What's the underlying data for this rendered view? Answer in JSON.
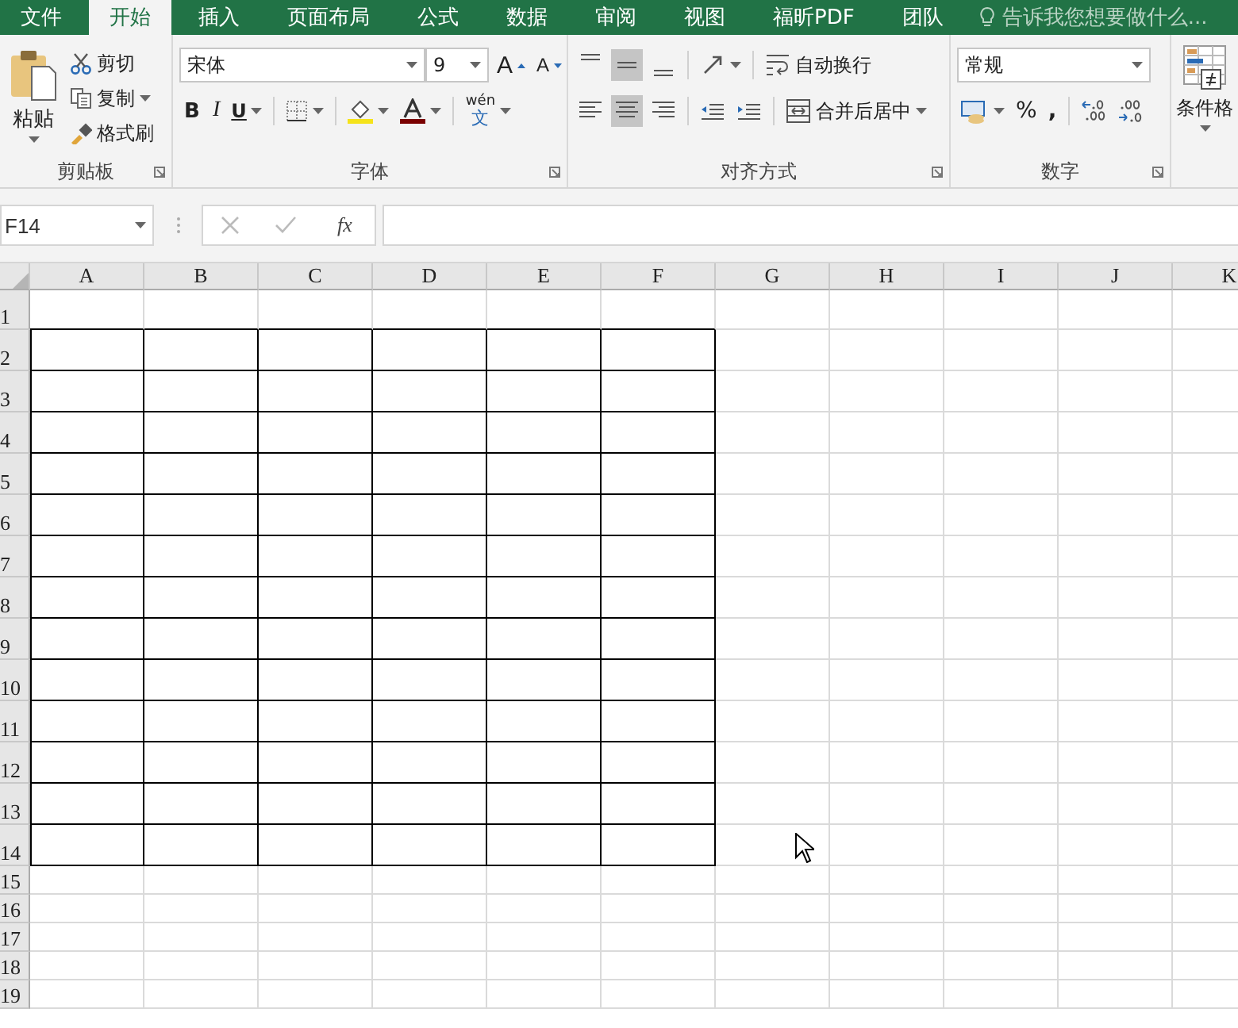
{
  "tabs": [
    {
      "label": "文件",
      "selected": false
    },
    {
      "label": "开始",
      "selected": true
    },
    {
      "label": "插入",
      "selected": false
    },
    {
      "label": "页面布局",
      "selected": false
    },
    {
      "label": "公式",
      "selected": false
    },
    {
      "label": "数据",
      "selected": false
    },
    {
      "label": "审阅",
      "selected": false
    },
    {
      "label": "视图",
      "selected": false
    },
    {
      "label": "福昕PDF",
      "selected": false
    },
    {
      "label": "团队",
      "selected": false
    }
  ],
  "tell_me": {
    "placeholder": "告诉我您想要做什么..."
  },
  "clipboard": {
    "paste": "粘贴",
    "cut": "剪切",
    "copy": "复制",
    "format_painter": "格式刷",
    "label": "剪贴板"
  },
  "font": {
    "name": "宋体",
    "size": "9",
    "grow": "A",
    "shrink": "A",
    "bold": "B",
    "italic": "I",
    "underline": "U",
    "phonetic_top": "wén",
    "phonetic_bottom": "文",
    "label": "字体"
  },
  "alignment": {
    "vertical_align": [
      {
        "selected": false
      },
      {
        "selected": true
      },
      {
        "selected": false
      }
    ],
    "horizontal_align": [
      {
        "selected": false
      },
      {
        "selected": true
      },
      {
        "selected": false
      }
    ],
    "wrap_text": "自动换行",
    "merge_center": "合并后居中",
    "label": "对齐方式"
  },
  "number": {
    "format": "常规",
    "percent": "%",
    "comma": ",",
    "label": "数字"
  },
  "styles": {
    "conditional_format": "条件格"
  },
  "formula_bar": {
    "name_box": "F14",
    "function_label": "fx"
  },
  "sheet": {
    "columns": [
      "A",
      "B",
      "C",
      "D",
      "E",
      "F",
      "G",
      "H",
      "I",
      "J",
      "K"
    ],
    "rows": [
      {
        "label": "1"
      },
      {
        "label": "2",
        "cells": [
          {
            "bordered": true
          },
          {
            "bordered": true
          },
          {
            "bordered": true
          },
          {
            "bordered": true
          },
          {
            "bordered": true
          },
          {
            "bordered": true
          }
        ]
      },
      {
        "label": "3",
        "cells": [
          {
            "bordered": true
          },
          {
            "bordered": true
          },
          {
            "bordered": true
          },
          {
            "bordered": true
          },
          {
            "bordered": true
          },
          {
            "bordered": true
          }
        ]
      },
      {
        "label": "4",
        "cells": [
          {
            "bordered": true
          },
          {
            "bordered": true
          },
          {
            "bordered": true
          },
          {
            "bordered": true
          },
          {
            "bordered": true
          },
          {
            "bordered": true
          }
        ]
      },
      {
        "label": "5",
        "cells": [
          {
            "bordered": true
          },
          {
            "bordered": true
          },
          {
            "bordered": true
          },
          {
            "bordered": true
          },
          {
            "bordered": true
          },
          {
            "bordered": true
          }
        ]
      },
      {
        "label": "6",
        "cells": [
          {
            "bordered": true
          },
          {
            "bordered": true
          },
          {
            "bordered": true
          },
          {
            "bordered": true
          },
          {
            "bordered": true
          },
          {
            "bordered": true
          }
        ]
      },
      {
        "label": "7",
        "cells": [
          {
            "bordered": true
          },
          {
            "bordered": true
          },
          {
            "bordered": true
          },
          {
            "bordered": true
          },
          {
            "bordered": true
          },
          {
            "bordered": true
          }
        ]
      },
      {
        "label": "8",
        "cells": [
          {
            "bordered": true
          },
          {
            "bordered": true
          },
          {
            "bordered": true
          },
          {
            "bordered": true
          },
          {
            "bordered": true
          },
          {
            "bordered": true
          }
        ]
      },
      {
        "label": "9",
        "cells": [
          {
            "bordered": true
          },
          {
            "bordered": true
          },
          {
            "bordered": true
          },
          {
            "bordered": true
          },
          {
            "bordered": true
          },
          {
            "bordered": true
          }
        ]
      },
      {
        "label": "10",
        "cells": [
          {
            "bordered": true
          },
          {
            "bordered": true
          },
          {
            "bordered": true
          },
          {
            "bordered": true
          },
          {
            "bordered": true
          },
          {
            "bordered": true
          }
        ]
      },
      {
        "label": "11",
        "cells": [
          {
            "bordered": true
          },
          {
            "bordered": true
          },
          {
            "bordered": true
          },
          {
            "bordered": true
          },
          {
            "bordered": true
          },
          {
            "bordered": true
          }
        ]
      },
      {
        "label": "12",
        "cells": [
          {
            "bordered": true
          },
          {
            "bordered": true
          },
          {
            "bordered": true
          },
          {
            "bordered": true
          },
          {
            "bordered": true
          },
          {
            "bordered": true
          }
        ]
      },
      {
        "label": "13",
        "cells": [
          {
            "bordered": true
          },
          {
            "bordered": true
          },
          {
            "bordered": true
          },
          {
            "bordered": true
          },
          {
            "bordered": true
          },
          {
            "bordered": true
          }
        ]
      },
      {
        "label": "14",
        "cells": [
          {
            "bordered": true
          },
          {
            "bordered": true
          },
          {
            "bordered": true
          },
          {
            "bordered": true
          },
          {
            "bordered": true
          },
          {
            "bordered": true
          }
        ]
      },
      {
        "label": "15"
      },
      {
        "label": "16"
      },
      {
        "label": "17"
      },
      {
        "label": "18"
      },
      {
        "label": "19"
      }
    ]
  }
}
